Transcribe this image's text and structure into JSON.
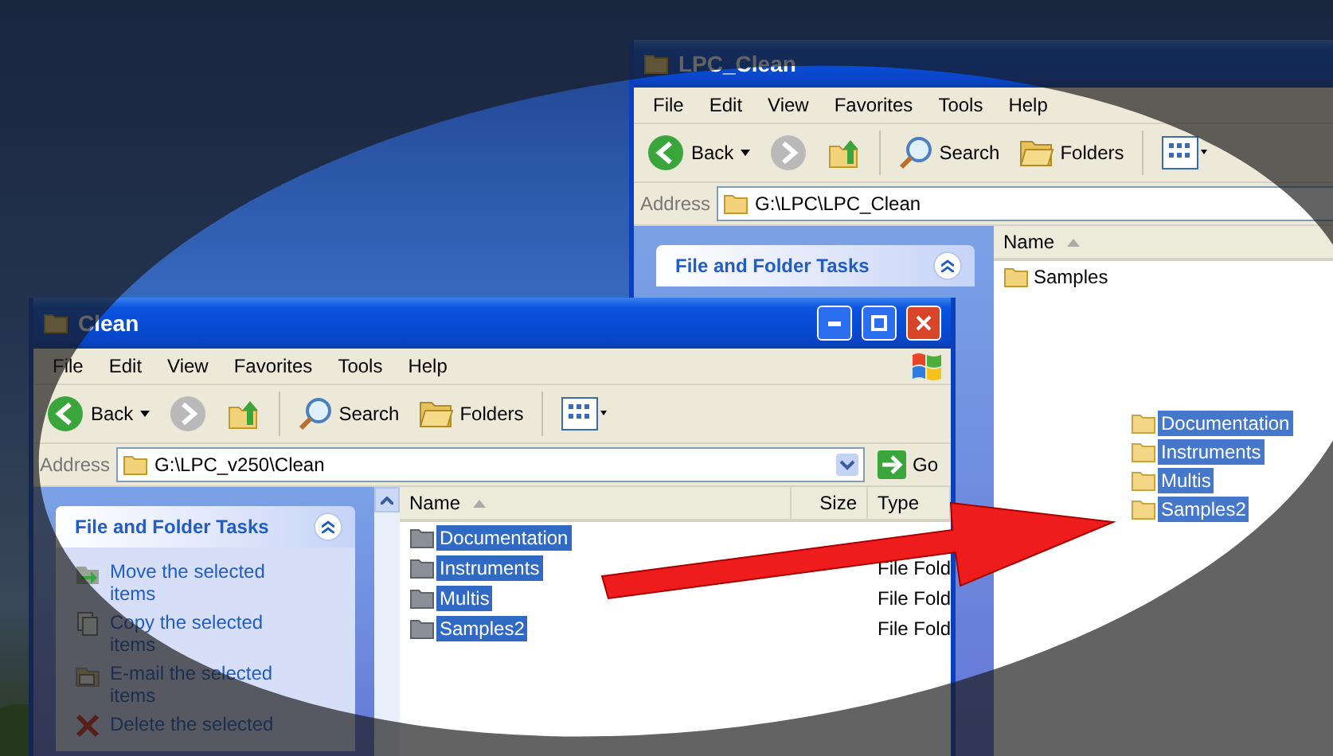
{
  "back_window": {
    "title": "LPC_Clean",
    "menu": [
      "File",
      "Edit",
      "View",
      "Favorites",
      "Tools",
      "Help"
    ],
    "toolbar": {
      "back": "Back",
      "search": "Search",
      "folders": "Folders"
    },
    "address": {
      "label": "Address",
      "value": "G:\\LPC\\LPC_Clean"
    },
    "tasks_title": "File and Folder Tasks",
    "columns": [
      "Name"
    ],
    "files": [
      {
        "name": "Samples",
        "selected": false
      }
    ]
  },
  "drag_items": [
    {
      "name": "Documentation",
      "selected": true
    },
    {
      "name": "Instruments",
      "selected": true
    },
    {
      "name": "Multis",
      "selected": true
    },
    {
      "name": "Samples2",
      "selected": true
    }
  ],
  "front_window": {
    "title": "Clean",
    "menu": [
      "File",
      "Edit",
      "View",
      "Favorites",
      "Tools",
      "Help"
    ],
    "toolbar": {
      "back": "Back",
      "search": "Search",
      "folders": "Folders"
    },
    "address": {
      "label": "Address",
      "value": "G:\\LPC_v250\\Clean",
      "go": "Go"
    },
    "tasks_title": "File and Folder Tasks",
    "tasks": [
      {
        "label": "Move the selected items",
        "kind": "move"
      },
      {
        "label": "Copy the selected items",
        "kind": "copy"
      },
      {
        "label": "E-mail the selected items",
        "kind": "email"
      },
      {
        "label": "Delete the selected",
        "kind": "delete"
      }
    ],
    "columns": [
      "Name",
      "Size",
      "Type"
    ],
    "files": [
      {
        "name": "Documentation",
        "selected": true
      },
      {
        "name": "Instruments",
        "type": "File Fold",
        "selected": true
      },
      {
        "name": "Multis",
        "type": "File Fold",
        "selected": true
      },
      {
        "name": "Samples2",
        "type": "File Fold",
        "selected": true
      }
    ]
  }
}
